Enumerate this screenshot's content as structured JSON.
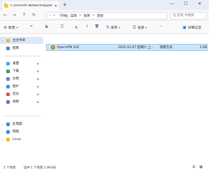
{
  "window": {
    "tab_title": "C:\\Users\\Pi Network\\AppData",
    "tab_close": "×",
    "new_tab": "+",
    "minimize": "—",
    "maximize": "☐",
    "close": "✕"
  },
  "nav": {
    "back": "←",
    "forward": "→",
    "up": "↑",
    "refresh": "↻",
    "breadcrumb_more": "›",
    "breadcrumb": [
      "「开始」菜单",
      "程序",
      "启动"
    ],
    "separator": ">",
    "search_placeholder": "在 启动 中搜索"
  },
  "toolbar": {
    "new_label": "新建",
    "cut": "✂",
    "copy": "⧉",
    "paste": "📋",
    "rename": "Ａ",
    "share": "⇪",
    "delete": "🗑",
    "sort_label": "排序",
    "view_label": "查看",
    "more": "···",
    "details_label": "详细信息"
  },
  "sidebar": {
    "items": [
      {
        "label": "主文件夹",
        "selected": true,
        "icon": "home-icon",
        "color": "#f0b43a"
      },
      {
        "label": "图库",
        "icon": "gallery-icon",
        "color": "#3b8ad8"
      },
      {
        "label": "桌面",
        "icon": "desktop-icon",
        "color": "#4aa3df",
        "pinned": true
      },
      {
        "label": "下载",
        "icon": "download-icon",
        "color": "#2f9e5a",
        "pinned": true
      },
      {
        "label": "文档",
        "icon": "documents-icon",
        "color": "#6b7fd1",
        "pinned": true
      },
      {
        "label": "图片",
        "icon": "pictures-icon",
        "color": "#3a8fd9",
        "pinned": true
      },
      {
        "label": "音乐",
        "icon": "music-icon",
        "color": "#e0564a",
        "pinned": true
      },
      {
        "label": "视频",
        "icon": "videos-icon",
        "color": "#8e5bd6",
        "pinned": true
      },
      {
        "label": "此电脑",
        "icon": "this-pc-icon",
        "color": "#3b8ad8"
      },
      {
        "label": "网络",
        "icon": "network-icon",
        "color": "#3b8ad8"
      },
      {
        "label": "Linux",
        "icon": "linux-icon",
        "color": "#f0b43a"
      }
    ],
    "pin_glyph": "✱",
    "expand_glyph": "›"
  },
  "files": [
    {
      "name": "OpenVPN GUI",
      "modified": "2025.02.07 星期六 上...",
      "type": "快捷方式",
      "size": "2 KB"
    }
  ],
  "status": {
    "count": "1 个项目",
    "selected": "选中 1 个项目  1.99 KB"
  }
}
